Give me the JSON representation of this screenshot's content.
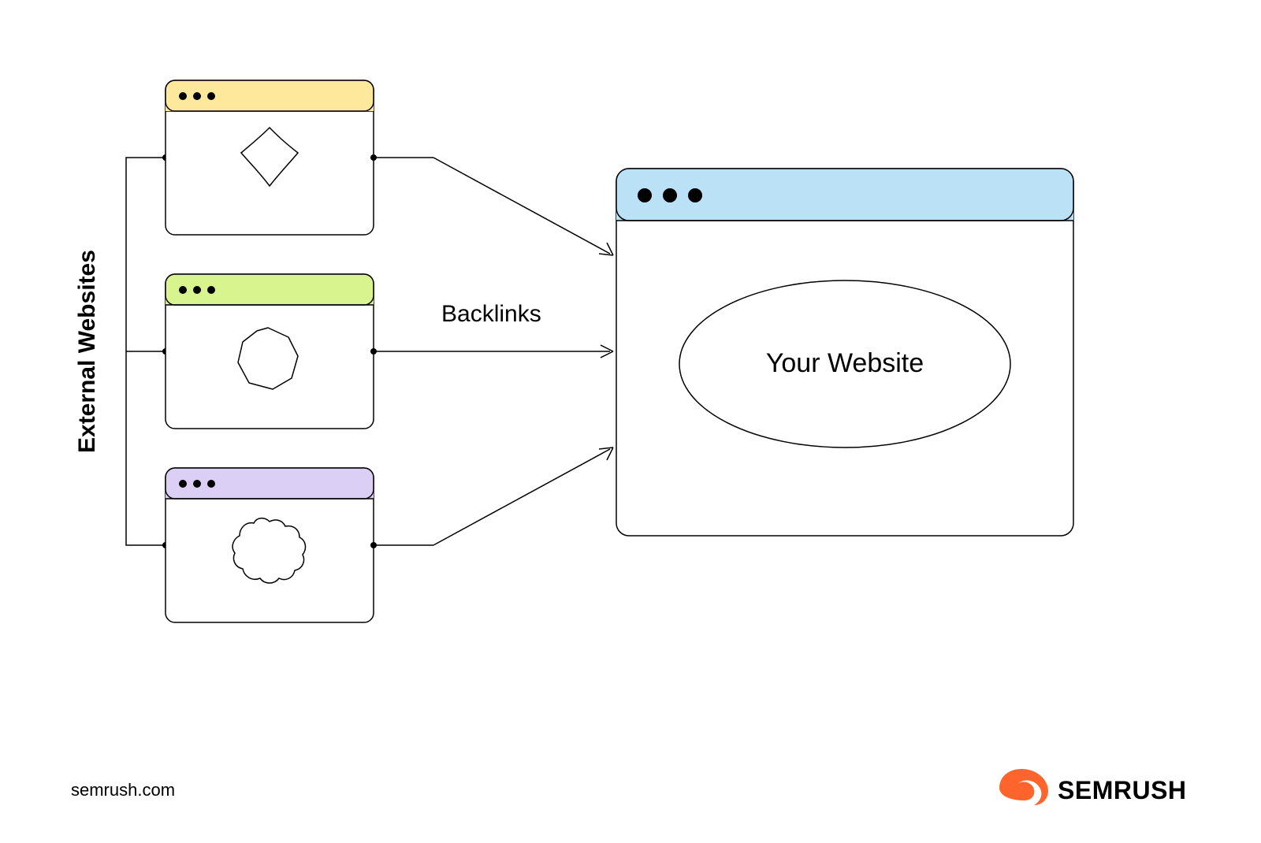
{
  "labels": {
    "external_sites": "External Websites",
    "backlinks": "Backlinks",
    "your_website": "Your Website"
  },
  "footer": {
    "domain": "semrush.com",
    "brand": "SEMRUSH"
  },
  "colors": {
    "header_yellow": "#FDE89B",
    "header_green": "#D8F48F",
    "header_purple": "#DCCFF5",
    "header_blue": "#BBE1F7",
    "brand_orange": "#FF642D",
    "stroke": "#000000"
  },
  "external_sites": [
    {
      "id": "site-1",
      "header_color": "header_yellow"
    },
    {
      "id": "site-2",
      "header_color": "header_green"
    },
    {
      "id": "site-3",
      "header_color": "header_purple"
    }
  ],
  "target_site": {
    "id": "your-website",
    "header_color": "header_blue"
  }
}
